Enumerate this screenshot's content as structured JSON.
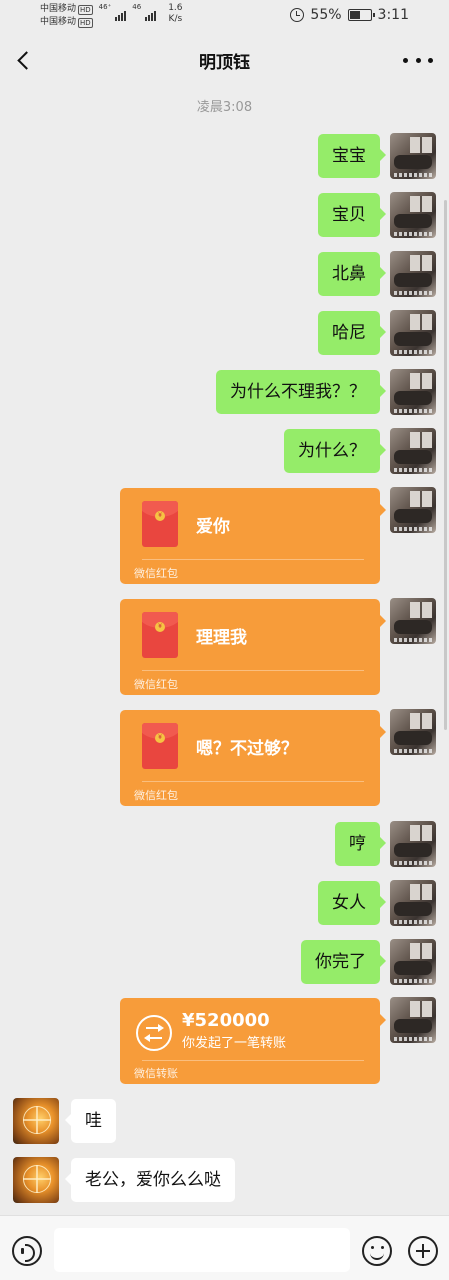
{
  "status_bar": {
    "carrier_1": "中国移动",
    "carrier_2": "中国移动",
    "hd_badge": "HD",
    "network_1": "46⁺",
    "network_2": "46",
    "speed_value": "1.6",
    "speed_unit": "K/s",
    "battery_percent": "55%",
    "battery_level": 0.55,
    "time": "3:11",
    "icons": [
      "alarm-icon",
      "battery-icon",
      "signal-icon"
    ]
  },
  "header": {
    "title": "明顶钰",
    "icons": [
      "back-arrow-icon",
      "more-dots-icon"
    ]
  },
  "chat": {
    "timestamp": "凌晨3:08",
    "texts": {
      "m1": "宝宝",
      "m2": "宝贝",
      "m3": "北鼻",
      "m4": "哈尼",
      "m5": "为什么不理我？？",
      "m6": "为什么？",
      "m10": "哼",
      "m11": "女人",
      "m12": "你完了",
      "r1": "哇",
      "r2": "老公，爱你么么哒"
    },
    "red_packets": {
      "rp1": "爱你",
      "rp2": "理理我",
      "rp3": "嗯？不过够？",
      "footer": "微信红包",
      "coin_symbol": "¥"
    },
    "transfer": {
      "amount": "¥520000",
      "note": "你发起了一笔转账",
      "footer": "微信转账"
    },
    "colors": {
      "sent_bubble": "#95ec69",
      "received_bubble": "#ffffff",
      "red_packet_card": "#f79c3a",
      "background": "#ededed"
    }
  },
  "input_bar": {
    "value": "",
    "icons": [
      "voice-icon",
      "emoji-icon",
      "plus-icon"
    ]
  }
}
